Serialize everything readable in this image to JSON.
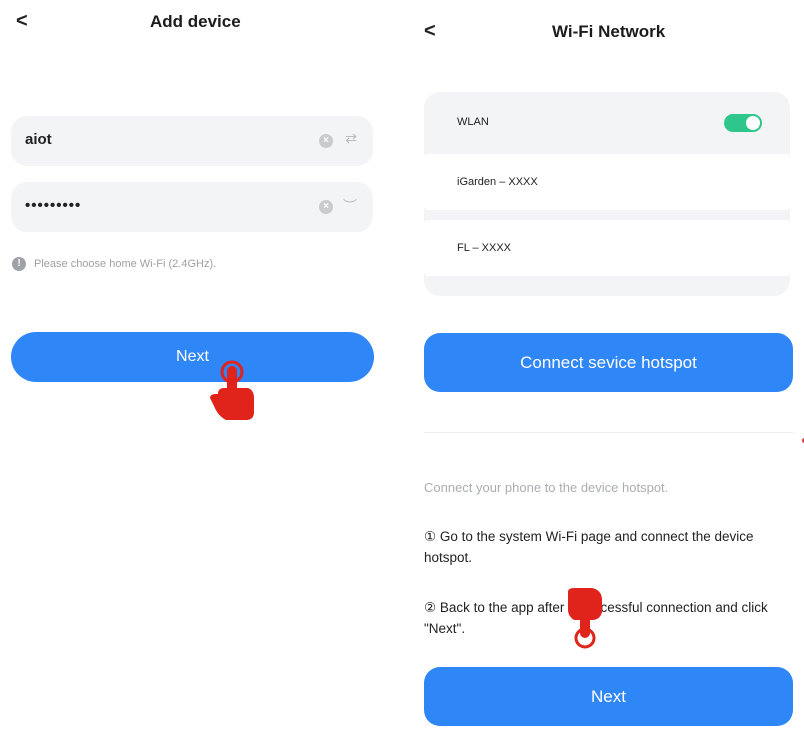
{
  "left_screen": {
    "back_glyph": "<",
    "title": "Add device",
    "ssid_field": {
      "value": "aiot",
      "clear_glyph": "×",
      "switch_glyph": "⇄"
    },
    "password_field": {
      "value": "•••••••••",
      "clear_glyph": "×",
      "eye_glyph": "︶"
    },
    "hint": {
      "icon_glyph": "!",
      "text": "Please choose home Wi-Fi (2.4GHz)."
    },
    "next_label": "Next"
  },
  "right_screen": {
    "back_glyph": "<",
    "title": "Wi-Fi Network",
    "wlan_label": "WLAN",
    "wlan_enabled": true,
    "networks": [
      "iGarden – XXXX",
      "FL – XXXX"
    ],
    "hotspot_button_label": "Connect sevice hotspot",
    "guide_text": "Connect your phone to the device hotspot.",
    "step1": "① Go to the system Wi-Fi page and connect the device hotspot.",
    "step2": "② Back to the app after a successful connection and click \"Next\".",
    "next_label": "Next"
  },
  "colors": {
    "accent": "#2f86f6",
    "toggle_on": "#2ec68a",
    "field_bg": "#f3f4f6",
    "pointer_hand": "#e0231b"
  },
  "icons": [
    "chevron-left-icon",
    "clear-icon",
    "swap-icon",
    "eye-closed-icon",
    "info-icon",
    "pointer-hand-icon"
  ]
}
